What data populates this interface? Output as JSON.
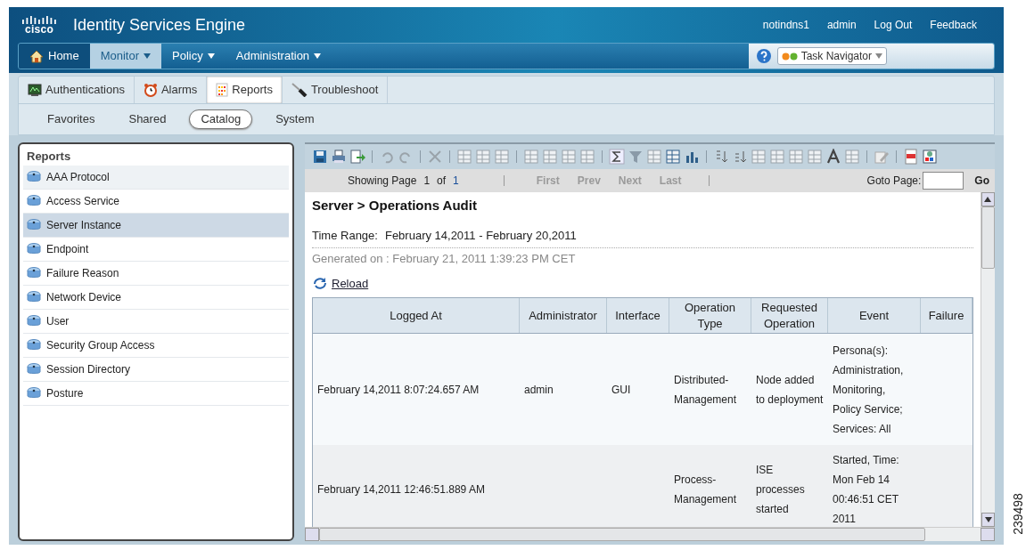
{
  "header": {
    "logo_text": "cisco",
    "title": "Identity Services Engine",
    "user_links": [
      "notindns1",
      "admin",
      "Log Out",
      "Feedback"
    ]
  },
  "nav": [
    {
      "label": "Home",
      "selected": false,
      "menu": false
    },
    {
      "label": "Monitor",
      "selected": true,
      "menu": true
    },
    {
      "label": "Policy",
      "selected": false,
      "menu": true
    },
    {
      "label": "Administration",
      "selected": false,
      "menu": true
    }
  ],
  "task_navigator": {
    "label": "Task Navigator"
  },
  "subtabs": [
    {
      "label": "Authentications",
      "selected": false,
      "kind": "monitor"
    },
    {
      "label": "Alarms",
      "selected": false,
      "kind": "clock"
    },
    {
      "label": "Reports",
      "selected": true,
      "kind": "report"
    },
    {
      "label": "Troubleshoot",
      "selected": false,
      "kind": "tool"
    }
  ],
  "catalog_tabs": [
    {
      "label": "Favorites",
      "selected": false
    },
    {
      "label": "Shared",
      "selected": false
    },
    {
      "label": "Catalog",
      "selected": true
    },
    {
      "label": "System",
      "selected": false
    }
  ],
  "sidebar": {
    "title": "Reports",
    "items": [
      {
        "label": "AAA Protocol",
        "selected": false
      },
      {
        "label": "Access Service",
        "selected": false
      },
      {
        "label": "Server Instance",
        "selected": true
      },
      {
        "label": "Endpoint",
        "selected": false
      },
      {
        "label": "Failure Reason",
        "selected": false
      },
      {
        "label": "Network Device",
        "selected": false
      },
      {
        "label": "User",
        "selected": false
      },
      {
        "label": "Security Group Access",
        "selected": false
      },
      {
        "label": "Session Directory",
        "selected": false
      },
      {
        "label": "Posture",
        "selected": false
      }
    ]
  },
  "pager": {
    "showing": "Showing Page",
    "page": "1",
    "of": "of",
    "total": "1",
    "buttons": [
      {
        "label": "First",
        "disabled": true
      },
      {
        "label": "Prev",
        "disabled": true
      },
      {
        "label": "Next",
        "disabled": true
      },
      {
        "label": "Last",
        "disabled": true
      }
    ],
    "goto_label": "Goto Page:",
    "go": "Go"
  },
  "report": {
    "title": "Server > Operations Audit",
    "time_range_label": "Time Range:",
    "time_range": "February 14,2011 - February 20,2011",
    "generated": "Generated on : February 21, 2011 1:39:23 PM CET",
    "reload": "Reload"
  },
  "table": {
    "columns": [
      "Logged At",
      "Administrator",
      "Interface",
      "Operation Type",
      "Requested Operation",
      "Event",
      "Failure"
    ],
    "rows": [
      [
        "February 14,2011 8:07:24.657 AM",
        "admin",
        "GUI",
        "Distributed-Management",
        "Node added to deployment",
        "Persona(s): Administration, Monitoring, Policy Service; Services: All",
        ""
      ],
      [
        "February 14,2011 12:46:51.889 AM",
        "",
        "",
        "Process-Management",
        "ISE processes started",
        "Started, Time: Mon Feb 14 00:46:51 CET 2011",
        ""
      ]
    ]
  },
  "figure_number": "239498"
}
